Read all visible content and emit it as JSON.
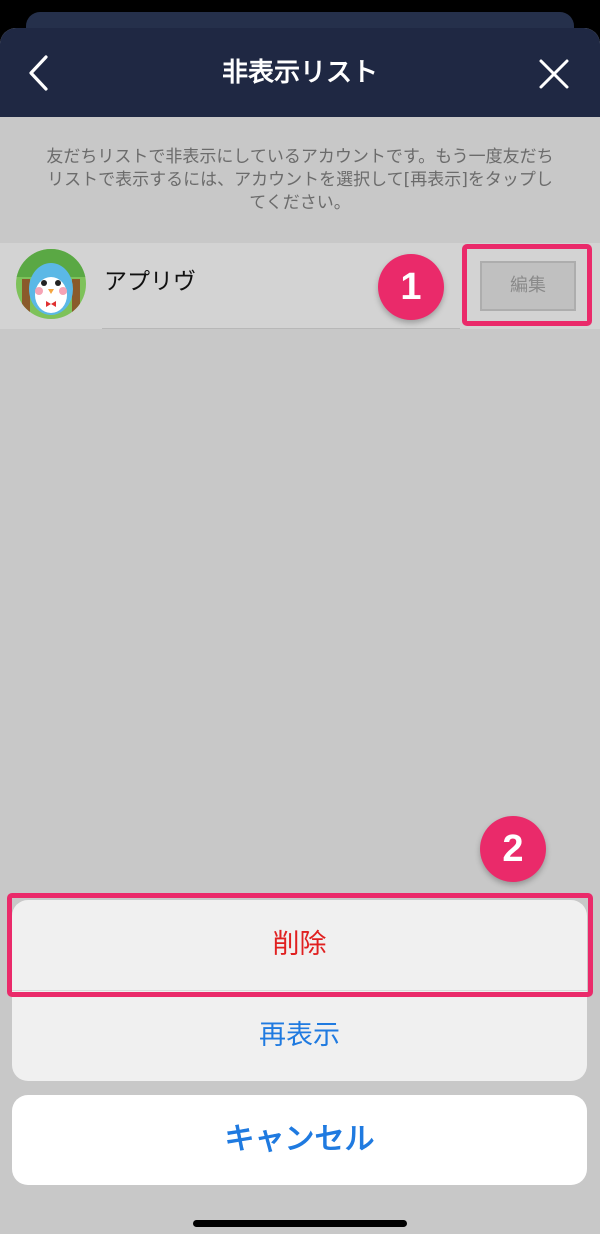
{
  "header": {
    "title": "非表示リスト",
    "bg_color": "#1f2843"
  },
  "description": {
    "line1": "友だちリストで非表示にしているアカウントです。もう一度友だち",
    "line2": "リストで表示するには、アカウントを選択して[再表示]をタップし",
    "line3": "てください。"
  },
  "hidden_list": {
    "items": [
      {
        "name": "アプリヴ",
        "edit_label": "編集",
        "avatar": "penguin-character"
      }
    ]
  },
  "annotations": {
    "badge1": "1",
    "badge2": "2",
    "highlight_color": "#ea2a6a"
  },
  "actions": {
    "delete_label": "削除",
    "delete_color": "#e02020",
    "unhide_label": "再表示",
    "unhide_color": "#1f7ae0",
    "cancel_label": "キャンセル"
  }
}
